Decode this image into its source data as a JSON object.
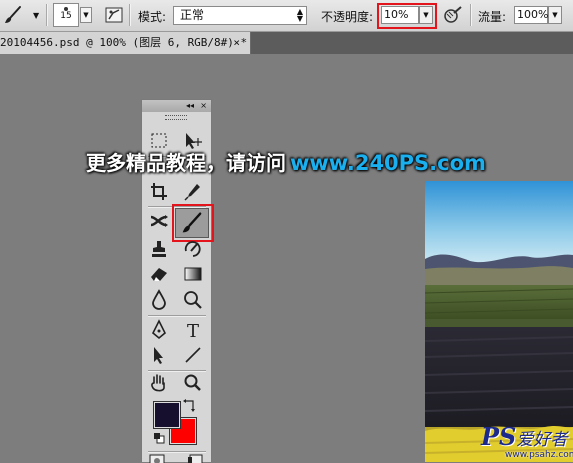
{
  "options_bar": {
    "brush_size": "15",
    "mode_label": "模式:",
    "mode_value": "正常",
    "opacity_label": "不透明度:",
    "opacity_value": "10%",
    "flow_label": "流量:",
    "flow_value": "100%"
  },
  "document_tab": {
    "title": "20104456.psd @ 100% (图层 6, RGB/8#) *",
    "close_label": "×"
  },
  "toolbox": {
    "collapse_label": "◂◂",
    "close_label": "×",
    "foreground_color": "#160f2e",
    "background_color": "#ff0000",
    "active_tool": "brush-tool"
  },
  "overlay": {
    "watermark_text": "更多精品教程，请访问",
    "watermark_url": "www.240PS.com",
    "logo_ps": "PS",
    "logo_cn": "爱好者",
    "logo_site": "www.psahz.com"
  },
  "colors": {
    "highlight": "#e3141b",
    "accent_url": "#1ab0ef"
  }
}
